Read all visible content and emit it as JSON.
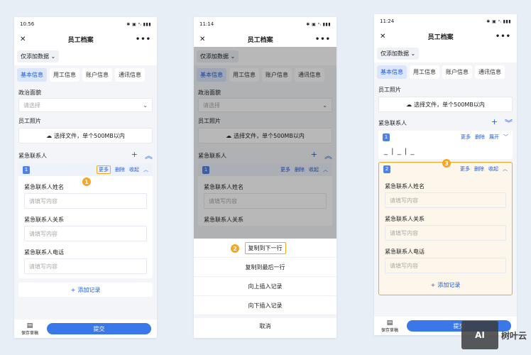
{
  "screens": [
    {
      "status_time": "10:56",
      "status_icons": "✱ ▣ ᵃᵢ ▮▮▮",
      "title": "员工档案",
      "filter": "仅添加数据",
      "tabs": [
        "基本信息",
        "用工信息",
        "账户信息",
        "通讯信息"
      ],
      "political_label": "政治面貌",
      "political_placeholder": "请选择",
      "photo_label": "员工照片",
      "upload_text": "选择文件，单个500MB以内",
      "emergency_label": "紧急联系人",
      "card_index": "1",
      "card_actions": [
        "更多",
        "删除",
        "收起"
      ],
      "fields": [
        {
          "label": "紧急联系人姓名",
          "placeholder": "请填写内容"
        },
        {
          "label": "紧急联系人关系",
          "placeholder": "请填写内容"
        },
        {
          "label": "紧急联系人电话",
          "placeholder": "请填写内容"
        }
      ],
      "add_record": "添加记录",
      "draft": "保存草稿",
      "submit": "提交",
      "step": "1"
    },
    {
      "status_time": "11:14",
      "status_icons": "✱ ▣ ᵃᵢ ▮▮▮",
      "title": "员工档案",
      "filter": "仅添加数据",
      "tabs": [
        "基本信息",
        "用工信息",
        "账户信息",
        "通讯信息"
      ],
      "political_label": "政治面貌",
      "political_placeholder": "请选择",
      "photo_label": "员工照片",
      "upload_text": "选择文件，单个500MB以内",
      "emergency_label": "紧急联系人",
      "card_index": "1",
      "card_actions": [
        "更多",
        "删除",
        "收起"
      ],
      "fields": [
        {
          "label": "紧急联系人姓名",
          "placeholder": "请填写内容"
        },
        {
          "label": "紧急联系人关系",
          "placeholder": ""
        }
      ],
      "sheet": [
        "复制到下一行",
        "复制到最后一行",
        "向上插入记录",
        "向下插入记录"
      ],
      "cancel": "取消",
      "step": "2"
    },
    {
      "status_time": "11:24",
      "status_icons": "✱ ▣ ᵃᵢ ▮▮▮",
      "title": "员工档案",
      "filter": "仅添加数据",
      "tabs": [
        "基本信息",
        "用工信息",
        "账户信息",
        "通讯信息"
      ],
      "photo_label": "员工照片",
      "upload_text": "选择文件，单个500MB以内",
      "emergency_label": "紧急联系人",
      "card1_index": "1",
      "card1_actions": [
        "更多",
        "删除",
        "展开"
      ],
      "card1_summary": "_ | _ | _",
      "card2_index": "2",
      "card2_actions": [
        "更多",
        "删除",
        "收起"
      ],
      "fields": [
        {
          "label": "紧急联系人姓名",
          "placeholder": "请填写内容"
        },
        {
          "label": "紧急联系人关系",
          "placeholder": "请填写内容"
        },
        {
          "label": "紧急联系人电话",
          "placeholder": "请填写内容"
        }
      ],
      "add_record": "添加记录",
      "draft": "保存草稿",
      "submit": "提交",
      "step": "3"
    }
  ],
  "watermark": {
    "logo": "AI",
    "text": "树叶云"
  },
  "colors": {
    "accent": "#3a78ea",
    "highlight": "#f5a623"
  }
}
